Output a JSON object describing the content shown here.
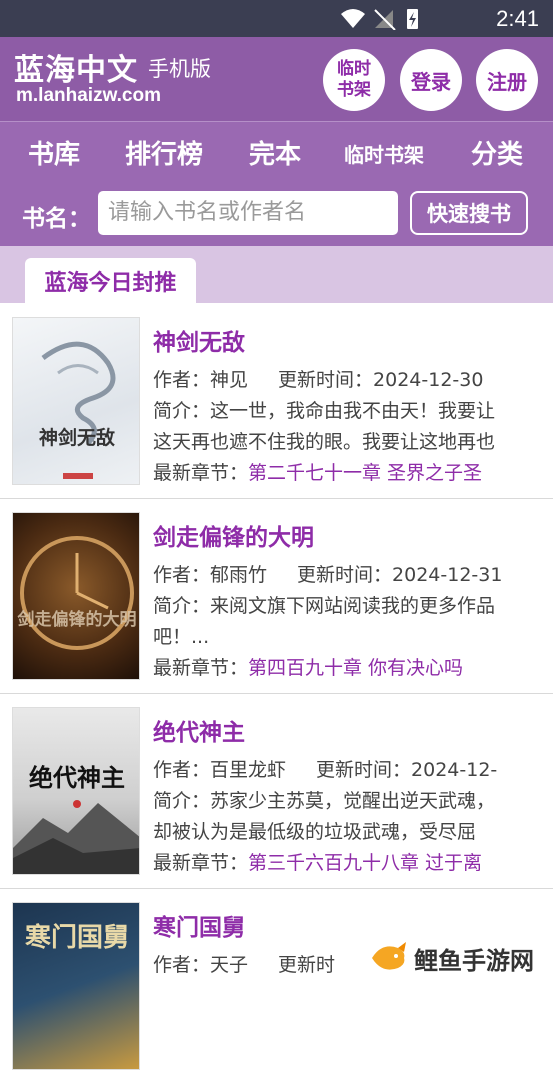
{
  "status_bar": {
    "time": "2:41"
  },
  "header": {
    "brand": "蓝海中文",
    "brand_sub": "手机版",
    "domain": "m.lanhaizw.com",
    "btn_temp_shelf_line1": "临时",
    "btn_temp_shelf_line2": "书架",
    "btn_login": "登录",
    "btn_register": "注册"
  },
  "nav": {
    "items": [
      "书库",
      "排行榜",
      "完本",
      "临时书架",
      "分类"
    ],
    "search_label": "书名：",
    "search_placeholder": "请输入书名或作者名",
    "search_button": "快速搜书"
  },
  "section": {
    "tab": "蓝海今日封推"
  },
  "books": [
    {
      "title": "神剑无敌",
      "author_label": "作者：",
      "author": "神见",
      "updated_label": "更新时间：",
      "updated": "2024-12-30",
      "intro_label": "简介：",
      "intro_1": "这一世，我命由我不由天！我要让",
      "intro_2": "这天再也遮不住我的眼。我要让这地再也",
      "latest_label": "最新章节：",
      "latest": "第二千七十一章 圣界之子圣",
      "cover_text": "神剑无敌"
    },
    {
      "title": "剑走偏锋的大明",
      "author_label": "作者：",
      "author": "郁雨竹",
      "updated_label": "更新时间：",
      "updated": "2024-12-31",
      "intro_label": "简介：",
      "intro_1": "来阅文旗下网站阅读我的更多作品",
      "intro_2": "吧！...",
      "latest_label": "最新章节：",
      "latest": "第四百九十章 你有决心吗",
      "cover_text": "剑走偏锋的大明"
    },
    {
      "title": "绝代神主",
      "author_label": "作者：",
      "author": "百里龙虾",
      "updated_label": "更新时间：",
      "updated": "2024-12-",
      "intro_label": "简介：",
      "intro_1": "苏家少主苏莫，觉醒出逆天武魂，",
      "intro_2": "却被认为是最低级的垃圾武魂，受尽屈",
      "latest_label": "最新章节：",
      "latest": "第三千六百九十八章 过于离",
      "cover_text": "绝代神主"
    },
    {
      "title": "寒门国舅",
      "author_label": "作者：",
      "author": "天子",
      "updated_label": "更新时",
      "updated": "",
      "cover_text": "寒门国舅"
    }
  ],
  "watermark": {
    "text": "鲤鱼手游网"
  },
  "colors": {
    "primary": "#8e5ca6",
    "accent": "#8e2ca8",
    "nav": "#9a69b2",
    "section": "#d9c5e3"
  }
}
